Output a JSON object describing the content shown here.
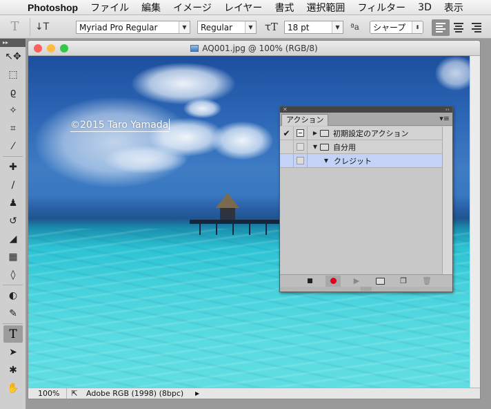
{
  "menubar": {
    "apple": "",
    "app": "Photoshop",
    "items": [
      "ファイル",
      "編集",
      "イメージ",
      "レイヤー",
      "書式",
      "選択範囲",
      "フィルター",
      "3D",
      "表示"
    ]
  },
  "options": {
    "tool_glyph": "T",
    "orient_glyph": "↓T",
    "font_family": "Myriad Pro Regular",
    "font_style": "Regular",
    "size_glyph": "ꚍT",
    "font_size": "18 pt",
    "aa_glyph": "ªa",
    "antialias": "シャープ"
  },
  "toolbox": {
    "header": "▸▸",
    "tools": [
      {
        "name": "move-icon",
        "glyph": "↖✥"
      },
      {
        "name": "marquee-icon",
        "glyph": "⬚"
      },
      {
        "name": "lasso-icon",
        "glyph": "ϱ"
      },
      {
        "name": "magic-wand-icon",
        "glyph": "✧"
      },
      {
        "name": "crop-icon",
        "glyph": "⌗"
      },
      {
        "name": "eyedropper-icon",
        "glyph": "⁄"
      },
      {
        "name": "healing-brush-icon",
        "glyph": "✚"
      },
      {
        "name": "brush-icon",
        "glyph": "∕"
      },
      {
        "name": "clone-stamp-icon",
        "glyph": "♟"
      },
      {
        "name": "history-brush-icon",
        "glyph": "↺"
      },
      {
        "name": "eraser-icon",
        "glyph": "◢"
      },
      {
        "name": "gradient-icon",
        "glyph": "▦"
      },
      {
        "name": "blur-icon",
        "glyph": "◊"
      },
      {
        "name": "dodge-icon",
        "glyph": "◐"
      },
      {
        "name": "pen-icon",
        "glyph": "✎"
      },
      {
        "name": "type-icon",
        "glyph": "T"
      },
      {
        "name": "path-selection-icon",
        "glyph": "➤"
      },
      {
        "name": "shape-icon",
        "glyph": "✱"
      },
      {
        "name": "hand-icon",
        "glyph": "✋"
      }
    ]
  },
  "document": {
    "title": "AQ001.jpg @ 100% (RGB/8)",
    "watermark": "©2015 Taro Yamada",
    "zoom": "100%",
    "profile": "Adobe RGB (1998) (8bpc)"
  },
  "actions_panel": {
    "collapse": "››",
    "tab": "アクション",
    "menu": "▾≡",
    "rows": [
      {
        "check": "✔",
        "dialog": true,
        "triangle": "▶",
        "indent": 0,
        "folder": true,
        "label": "初期設定のアクション",
        "selected": false
      },
      {
        "check": "",
        "dialog": false,
        "triangle": "▼",
        "indent": 0,
        "folder": true,
        "label": "自分用",
        "selected": false
      },
      {
        "check": "",
        "dialog": false,
        "triangle": "▼",
        "indent": 1,
        "folder": false,
        "label": "クレジット",
        "selected": true
      }
    ]
  },
  "colors": {
    "record": "#e0001b",
    "selection": "#c4d2f7",
    "close": "#fc605c",
    "minimize": "#fdbc40",
    "zoom": "#34c84a"
  }
}
